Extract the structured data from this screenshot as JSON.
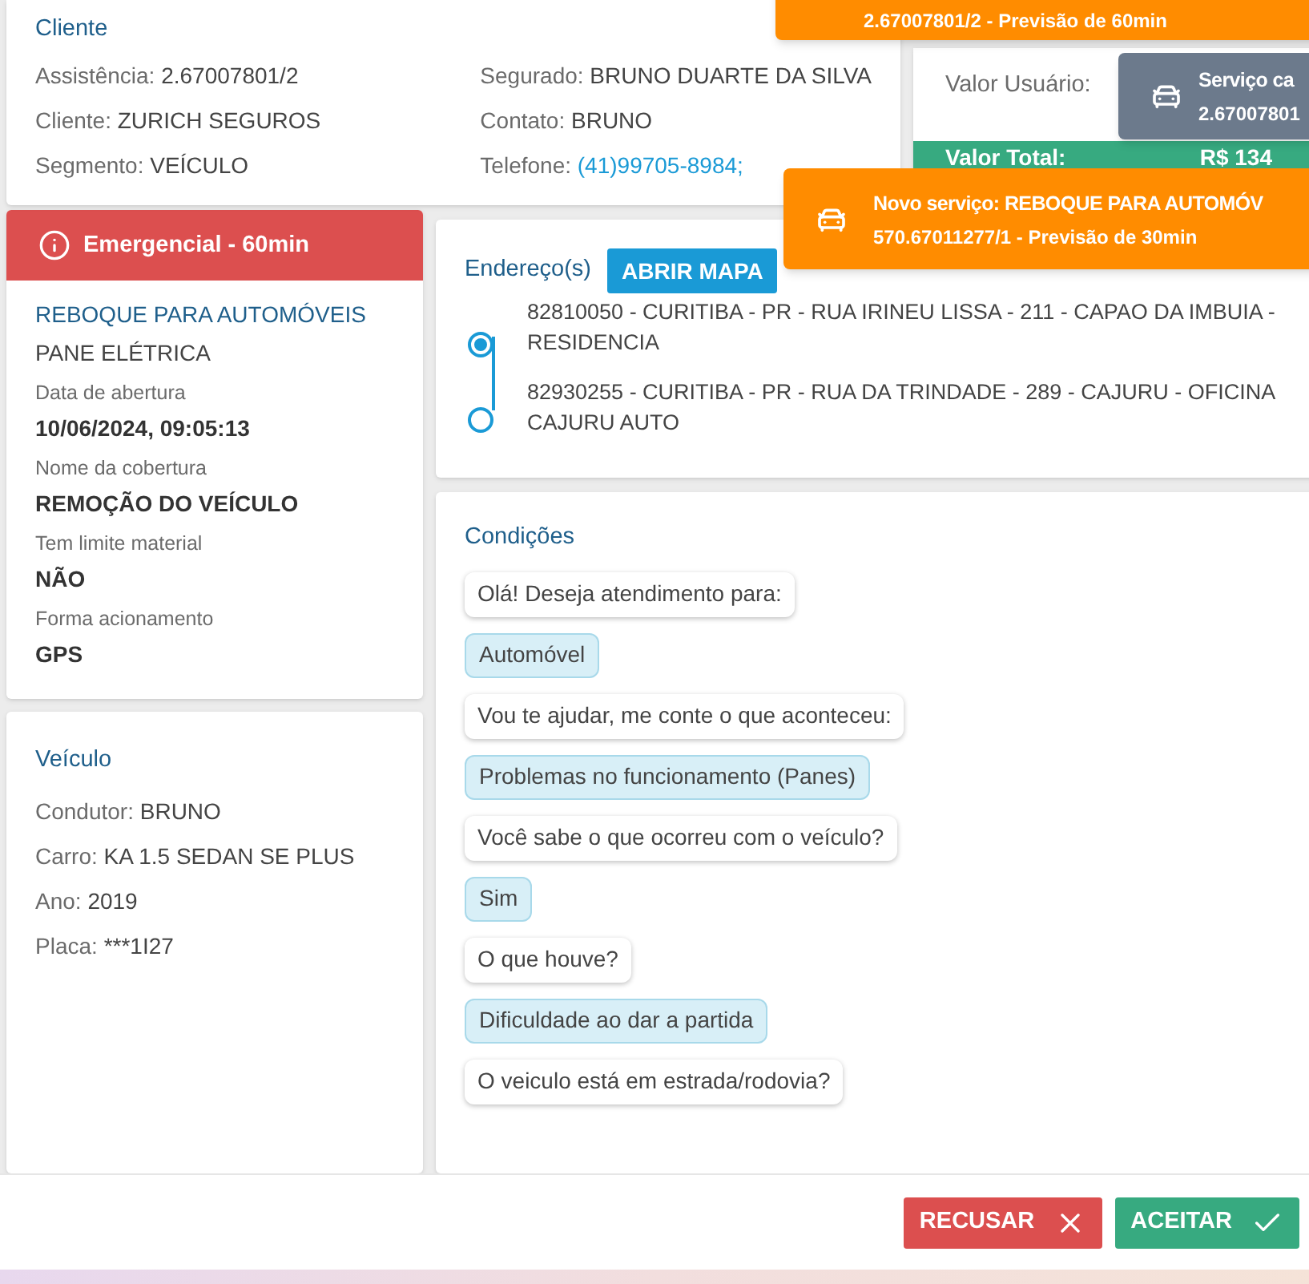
{
  "client_card": {
    "title": "Cliente",
    "left_fields": [
      {
        "label": "Assistência:",
        "value": "2.67007801/2"
      },
      {
        "label": "Cliente:",
        "value": "ZURICH SEGUROS"
      },
      {
        "label": "Segmento:",
        "value": "VEÍCULO"
      }
    ],
    "right_fields": [
      {
        "label": "Segurado:",
        "value": "BRUNO DUARTE DA SILVA"
      },
      {
        "label": "Contato:",
        "value": "BRUNO"
      },
      {
        "label": "Telefone:",
        "value": "(41)99705-8984;",
        "kind": "link"
      }
    ]
  },
  "values_panel": {
    "user_value_label": "Valor Usuário:",
    "total_label": "Valor Total:",
    "total_value": "R$ 134"
  },
  "service_card": {
    "priority": "Emergencial - 60min",
    "service": "REBOQUE PARA AUTOMÓVEIS",
    "problem": "PANE ELÉTRICA",
    "details": [
      {
        "label": "Data de abertura",
        "value": "10/06/2024, 09:05:13"
      },
      {
        "label": "Nome da cobertura",
        "value": "REMOÇÃO DO VEÍCULO"
      },
      {
        "label": "Tem limite material",
        "value": "NÃO"
      },
      {
        "label": "Forma acionamento",
        "value": "GPS"
      }
    ]
  },
  "vehicle_card": {
    "title": "Veículo",
    "fields": [
      {
        "label": "Condutor:",
        "value": "BRUNO"
      },
      {
        "label": "Carro:",
        "value": "KA 1.5 SEDAN SE PLUS"
      },
      {
        "label": "Ano:",
        "value": "2019"
      },
      {
        "label": "Placa:",
        "value": "***1I27"
      }
    ]
  },
  "addresses": {
    "title": "Endereço(s)",
    "map_button": "ABRIR MAPA",
    "items": [
      {
        "text": "82810050 - CURITIBA - PR - RUA IRINEU LISSA - 211 - CAPAO DA IMBUIA - RESIDENCIA",
        "selected": true
      },
      {
        "text": "82930255 - CURITIBA - PR - RUA DA TRINDADE - 289 - CAJURU - OFICINA CAJURU AUTO",
        "selected": false
      }
    ]
  },
  "conditions": {
    "title": "Condições",
    "messages": [
      {
        "kind": "question",
        "text": "Olá! Deseja atendimento para:"
      },
      {
        "kind": "answer",
        "text": "Automóvel"
      },
      {
        "kind": "question",
        "text": "Vou te ajudar, me conte o que aconteceu:"
      },
      {
        "kind": "answer",
        "text": "Problemas no funcionamento (Panes)"
      },
      {
        "kind": "question",
        "text": "Você sabe o que ocorreu com o veículo?"
      },
      {
        "kind": "answer",
        "text": "Sim"
      },
      {
        "kind": "question",
        "text": "O que houve?"
      },
      {
        "kind": "answer",
        "text": "Dificuldade ao dar a partida"
      },
      {
        "kind": "question",
        "text": "O veiculo está em estrada/rodovia?"
      }
    ]
  },
  "actions": [
    {
      "kind": "reject",
      "label": "RECUSAR"
    },
    {
      "kind": "accept",
      "label": "ACEITAR"
    }
  ],
  "notifications": [
    {
      "kind": "warning",
      "subtitle": "2.67007801/2 - Previsão de 60min"
    },
    {
      "kind": "neutral",
      "title": "Serviço ca",
      "subtitle": "2.67007801"
    },
    {
      "kind": "warning",
      "title": "Novo serviço: REBOQUE PARA AUTOMÓV",
      "subtitle": "570.67011277/1 - Previsão de 30min"
    }
  ]
}
